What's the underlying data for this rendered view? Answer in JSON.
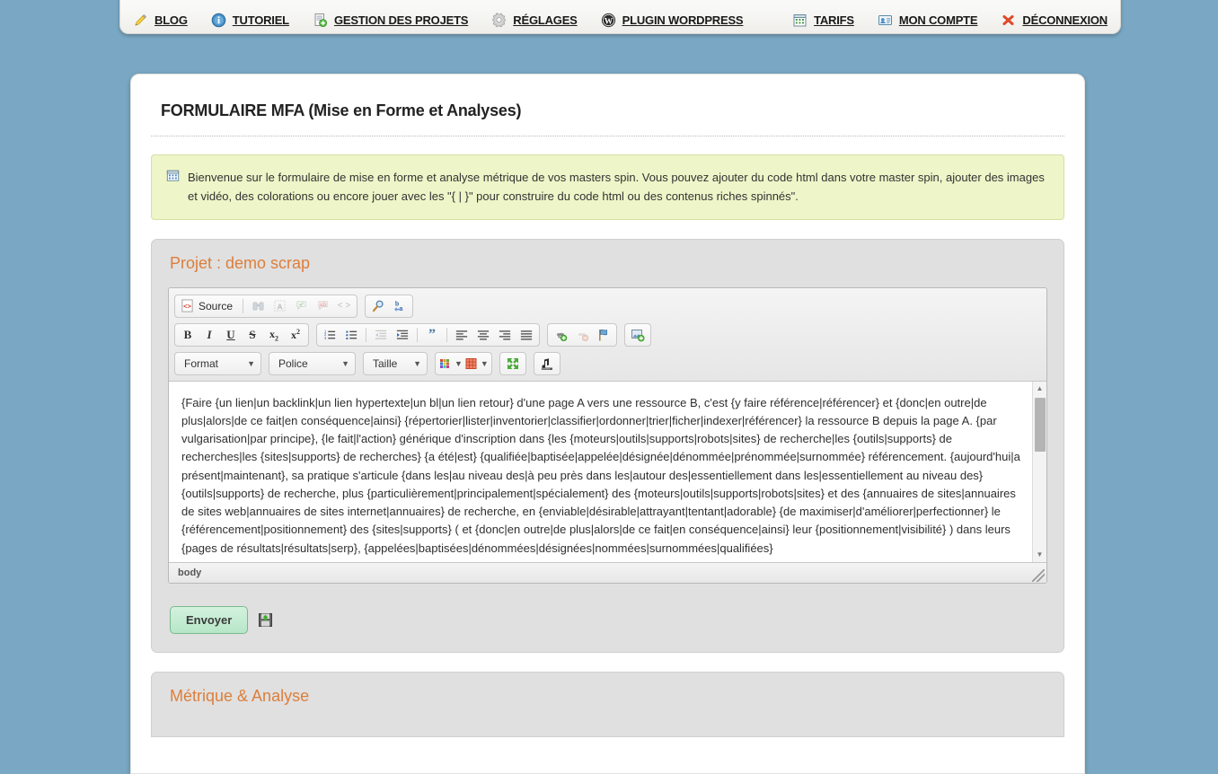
{
  "nav": {
    "left": [
      {
        "label": "BLOG",
        "icon": "pencil-icon"
      },
      {
        "label": "TUTORIEL",
        "icon": "info-icon"
      },
      {
        "label": "GESTION DES PROJETS",
        "icon": "document-add-icon"
      },
      {
        "label": "RÉGLAGES",
        "icon": "gear-icon"
      },
      {
        "label": "PLUGIN WORDPRESS",
        "icon": "wordpress-icon"
      }
    ],
    "right": [
      {
        "label": "TARIFS",
        "icon": "calendar-icon"
      },
      {
        "label": "MON COMPTE",
        "icon": "id-card-icon"
      },
      {
        "label": "DÉCONNEXION",
        "icon": "logout-cross-icon"
      }
    ]
  },
  "page": {
    "title": "FORMULAIRE MFA (Mise en Forme et Analyses)",
    "info_icon": "calendar-icon",
    "info_text": "Bienvenue sur le formulaire de mise en forme et analyse métrique de vos masters spin. Vous pouvez ajouter du code html dans votre master spin, ajouter des images et vidéo, des colorations ou encore jouer avec les \"{ | }\" pour construire du code html ou des contenus riches spinnés\"."
  },
  "project_panel": {
    "title": "Projet : demo scrap"
  },
  "editor": {
    "toolbar": {
      "source_label": "Source",
      "row1_group1": [
        {
          "name": "source-button",
          "icon": "source-code-icon",
          "disabled": false
        },
        {
          "name": "find-button",
          "icon": "binoculars-icon",
          "disabled": true
        },
        {
          "name": "select-all-button",
          "icon": "select-all-icon",
          "disabled": true
        },
        {
          "name": "spellcheck-button",
          "icon": "spellcheck-icon",
          "disabled": true
        },
        {
          "name": "spellcheck-options-button",
          "icon": "spellcheck-red-icon",
          "disabled": true
        },
        {
          "name": "show-blocks-button",
          "icon": "angle-brackets-icon",
          "disabled": true
        }
      ],
      "row1_group2": [
        {
          "name": "search-button",
          "icon": "magnifier-icon",
          "disabled": false
        },
        {
          "name": "replace-button",
          "icon": "find-replace-icon",
          "disabled": false
        }
      ],
      "row2_group1": [
        {
          "name": "bold-button",
          "icon": "bold-icon",
          "glyph": "B"
        },
        {
          "name": "italic-button",
          "icon": "italic-icon",
          "glyph": "I"
        },
        {
          "name": "underline-button",
          "icon": "underline-icon",
          "glyph": "U"
        },
        {
          "name": "strike-button",
          "icon": "strikethrough-icon",
          "glyph": "S"
        },
        {
          "name": "subscript-button",
          "icon": "subscript-icon",
          "glyph": "x₂"
        },
        {
          "name": "superscript-button",
          "icon": "superscript-icon",
          "glyph": "x²"
        }
      ],
      "row2_group2": [
        {
          "name": "numbered-list-button",
          "icon": "numbered-list-icon",
          "disabled": false
        },
        {
          "name": "bulleted-list-button",
          "icon": "bulleted-list-icon",
          "disabled": false
        },
        {
          "name": "outdent-button",
          "icon": "outdent-icon",
          "disabled": true
        },
        {
          "name": "indent-button",
          "icon": "indent-icon",
          "disabled": false
        },
        {
          "name": "blockquote-button",
          "icon": "quote-icon",
          "disabled": false
        },
        {
          "name": "align-left-button",
          "icon": "align-left-icon",
          "disabled": false
        },
        {
          "name": "align-center-button",
          "icon": "align-center-icon",
          "disabled": false
        },
        {
          "name": "align-right-button",
          "icon": "align-right-icon",
          "disabled": false
        },
        {
          "name": "align-justify-button",
          "icon": "align-justify-icon",
          "disabled": false
        }
      ],
      "row2_group3": [
        {
          "name": "link-button",
          "icon": "link-icon",
          "disabled": false
        },
        {
          "name": "unlink-button",
          "icon": "unlink-icon",
          "disabled": true
        },
        {
          "name": "anchor-button",
          "icon": "anchor-flag-icon",
          "disabled": false
        }
      ],
      "row2_group4": [
        {
          "name": "image-button",
          "icon": "image-add-icon",
          "disabled": false
        }
      ],
      "format_label": "Format",
      "police_label": "Police",
      "taille_label": "Taille",
      "row3_group": [
        {
          "name": "text-color-button",
          "icon": "text-color-icon"
        },
        {
          "name": "background-color-button",
          "icon": "background-color-icon"
        },
        {
          "name": "maximize-button",
          "icon": "maximize-icon"
        },
        {
          "name": "media-embed-button",
          "icon": "media-embed-icon"
        }
      ]
    },
    "content": "{Faire {un lien|un backlink|un lien hypertexte|un bl|un lien retour} d'une page A vers une ressource B, c'est {y faire référence|référencer} et {donc|en outre|de plus|alors|de ce fait|en conséquence|ainsi} {répertorier|lister|inventorier|classifier|ordonner|trier|ficher|indexer|référencer} la ressource B depuis la page A. {par vulgarisation|par principe}, {le fait|l'action} générique d'inscription dans {les {moteurs|outils|supports|robots|sites} de recherche|les {outils|supports} de recherches|les {sites|supports} de recherches} {a été|est} {qualifiée|baptisée|appelée|désignée|dénommée|prénommée|surnommée} référencement. {aujourd'hui|a présent|maintenant}, sa pratique s'articule {dans les|au niveau des|à peu près dans les|autour des|essentiellement dans les|essentiellement au niveau des} {outils|supports} de recherche, plus {particulièrement|principalement|spécialement} des {moteurs|outils|supports|robots|sites} et des {annuaires de sites|annuaires de sites web|annuaires de sites internet|annuaires} de recherche, en {enviable|désirable|attrayant|tentant|adorable} {de maximiser|d'améliorer|perfectionner} le {référencement|positionnement} des {sites|supports} ( et {donc|en outre|de plus|alors|de ce fait|en conséquence|ainsi} leur {positionnement|visibilité} ) dans leurs {pages de résultats|résultats|serp}, {appelées|baptisées|dénommées|désignées|nommées|surnommées|qualifiées}",
    "status_path": "body"
  },
  "submit": {
    "label": "Envoyer",
    "icon": "save-import-icon"
  },
  "metrics_panel": {
    "title": "Métrique & Analyse"
  },
  "colors": {
    "page_background": "#7aa8c4",
    "accent_orange": "#dd7e3a",
    "info_background": "#eef5c8",
    "panel_background": "#e0e0e0",
    "submit_green": "#b6e6c8"
  }
}
